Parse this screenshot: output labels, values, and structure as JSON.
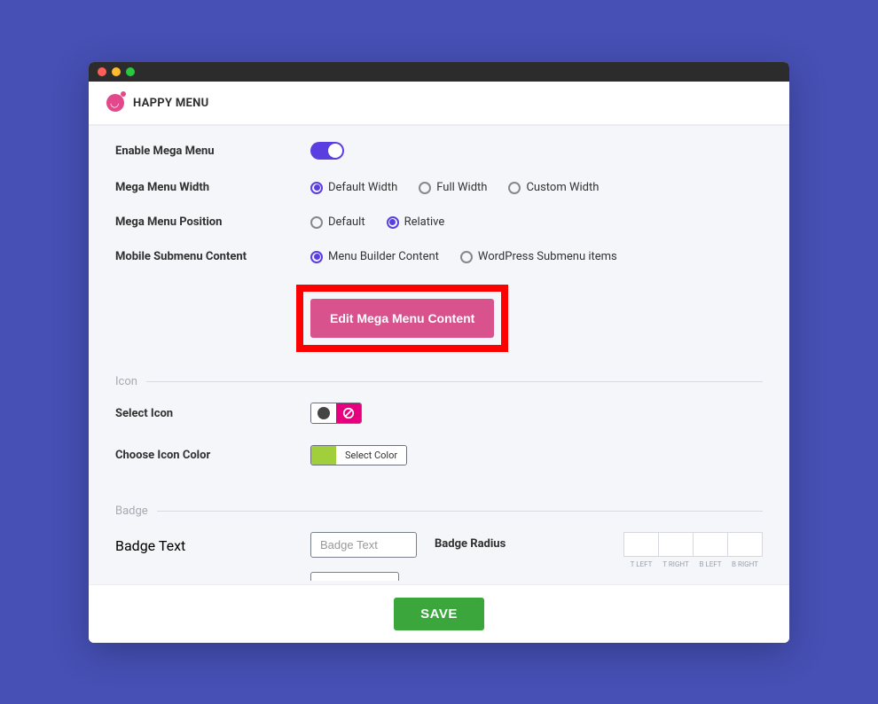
{
  "header": {
    "title": "HAPPY MENU"
  },
  "form": {
    "enable_label": "Enable Mega Menu",
    "width_label": "Mega Menu Width",
    "width_opts": {
      "default": "Default Width",
      "full": "Full Width",
      "custom": "Custom Width"
    },
    "position_label": "Mega Menu Position",
    "position_opts": {
      "default": "Default",
      "relative": "Relative"
    },
    "submenu_label": "Mobile Submenu Content",
    "submenu_opts": {
      "builder": "Menu Builder Content",
      "wp": "WordPress Submenu items"
    },
    "edit_button": "Edit Mega Menu Content"
  },
  "icon_section": {
    "title": "Icon",
    "select_label": "Select Icon",
    "color_label": "Choose Icon Color",
    "select_color_text": "Select Color"
  },
  "badge_section": {
    "title": "Badge",
    "text_label": "Badge Text",
    "text_placeholder": "Badge Text",
    "radius_label": "Badge Radius",
    "corners": {
      "tl": "T LEFT",
      "tr": "T RIGHT",
      "bl": "B LEFT",
      "br": "B RIGHT"
    }
  },
  "footer": {
    "save": "SAVE"
  }
}
